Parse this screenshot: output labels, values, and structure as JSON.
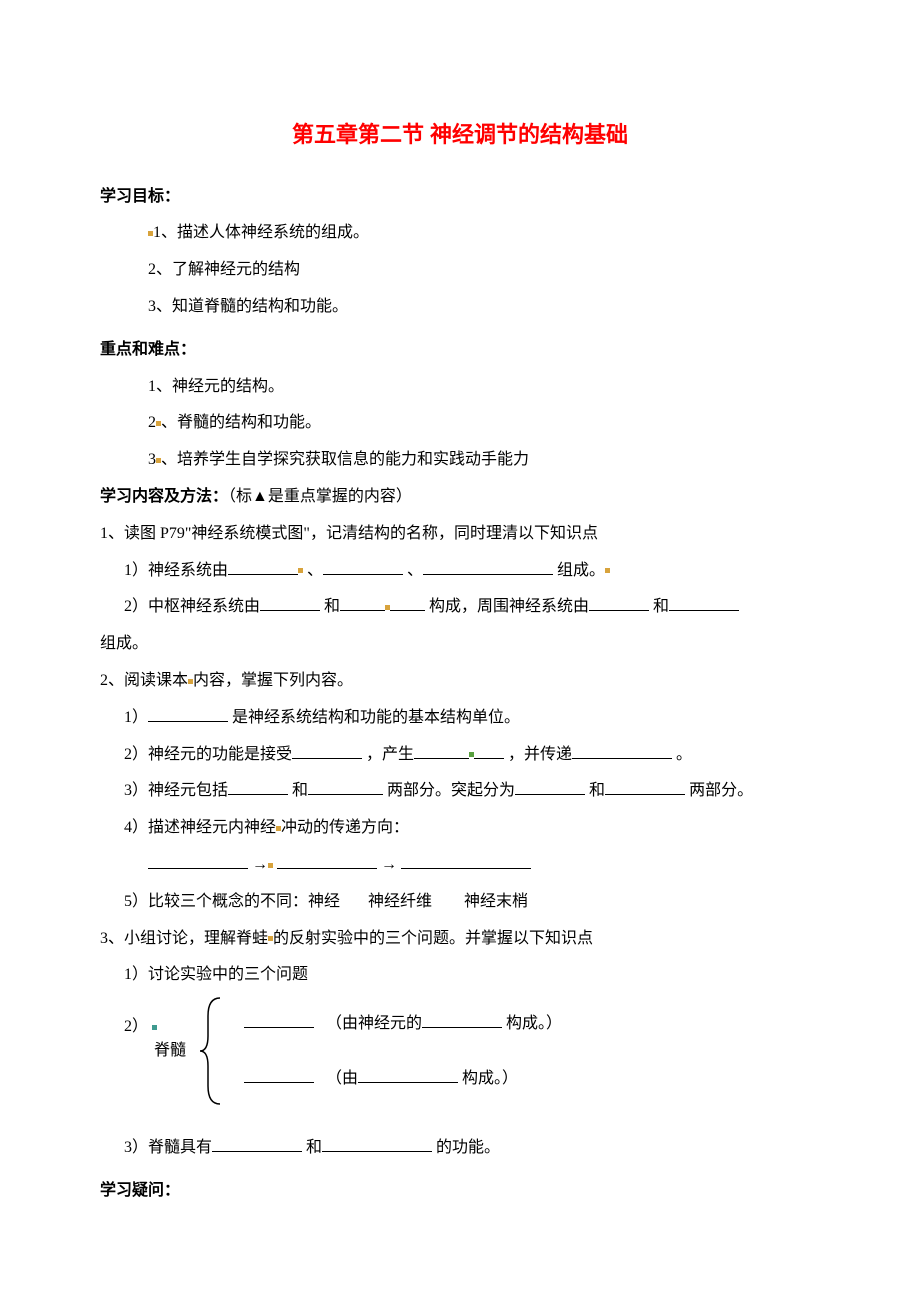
{
  "title": "第五章第二节 神经调节的结构基础",
  "sec1": {
    "label": "学习目标：",
    "i1": "1、描述人体神经系统的组成。",
    "i2": "2、了解神经元的结构",
    "i3": "3、知道脊髓的结构和功能。"
  },
  "sec2": {
    "label": "重点和难点：",
    "i1": "1、神经元的结构。",
    "i2": "、脊髓的结构和功能。",
    "i2_prefix": "2",
    "i3_prefix": "3",
    "i3": "、培养学生自学探究获取信息的能力和实践动手能力"
  },
  "sec3": {
    "label": "学习内容及方法：",
    "note": "（标▲是重点掌握的内容）"
  },
  "q1": {
    "lead": "1、读图 P79\"神经系统模式图\"，记清结构的名称，同时理清以下知识点",
    "s1a": "1）神经系统由",
    "s1b": "、",
    "s1c": "、",
    "s1d": "组成。",
    "s2a": "2）中枢神经系统由",
    "s2b": "和",
    "s2c": "构成，周围神经系统由",
    "s2d": "和",
    "s2e": "组成。"
  },
  "q2": {
    "lead": "2、阅读课本内容，掌握下列内容。",
    "lead2": "内容，掌握下列内容。",
    "s1a": "1）",
    "s1b": "是神经系统结构和功能的基本结构单位。",
    "s2a": "2）神经元的功能是接受",
    "s2b": "，产生",
    "s2c": "，并传递",
    "s2d": "。",
    "s3a": "3）神经元包括",
    "s3b": "和",
    "s3c": "两部分。突起分为",
    "s3d": "和",
    "s3e": "两部分。",
    "s4": "4）描述神经元内神经冲动的传递方向：",
    "s4_dirmid": "冲动的传递方向：",
    "s5a": "5）比较三个概念的不同：神经",
    "s5b": "神经纤维",
    "s5c": "神经末梢"
  },
  "q3": {
    "lead": "3、小组讨论，理解脊蛙的反射实验中的三个问题。并掌握以下知识点",
    "lead2": "的反射实验中的三个问题。并掌握以下知识点",
    "s1": "1）讨论实验中的三个问题",
    "s2": "2）",
    "spine": "脊髓",
    "b1a": "（由神经元的",
    "b1b": "构成。）",
    "b2a": "（由",
    "b2b": "构成。）",
    "s3a": "3）脊髓具有",
    "s3b": "和",
    "s3c": "的功能。"
  },
  "sec4": {
    "label": "学习疑问："
  }
}
